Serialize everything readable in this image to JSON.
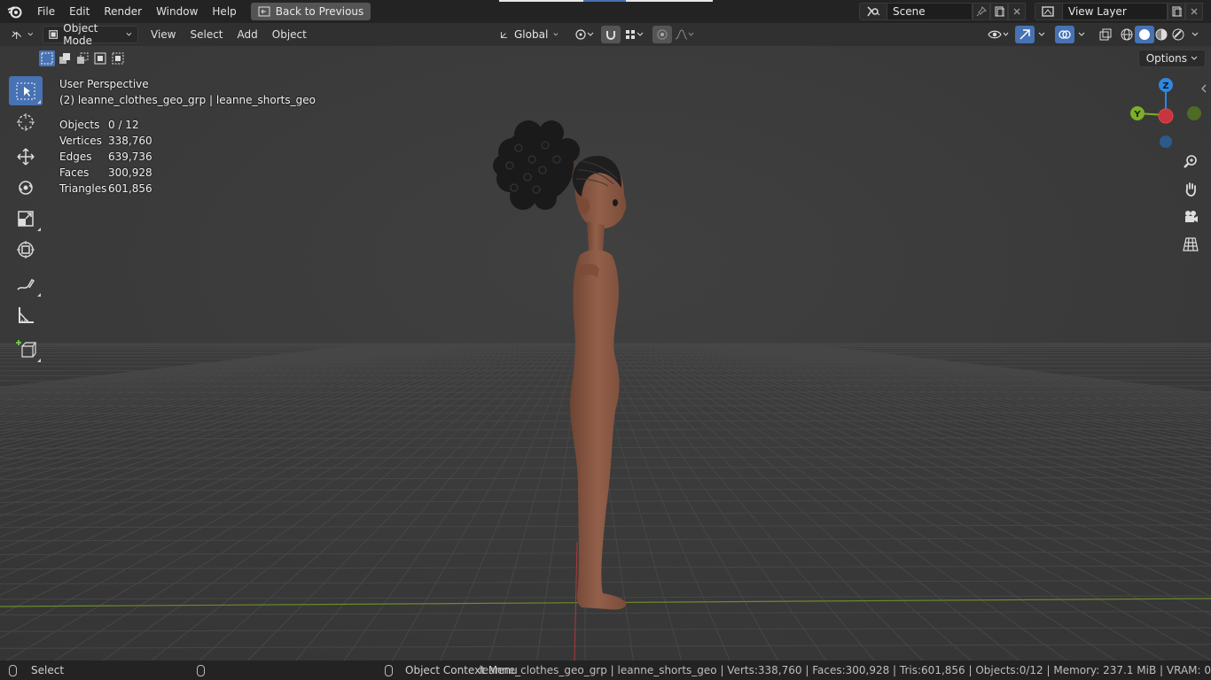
{
  "menu": {
    "items": [
      "File",
      "Edit",
      "Render",
      "Window",
      "Help"
    ],
    "back_button": "Back to Previous"
  },
  "scene": {
    "name": "Scene",
    "view_layer": "View Layer"
  },
  "header": {
    "mode": "Object Mode",
    "menus": [
      "View",
      "Select",
      "Add",
      "Object"
    ],
    "transform_orientation": "Global",
    "options_label": "Options"
  },
  "viewport": {
    "perspective": "User Perspective",
    "active_object": "(2) leanne_clothes_geo_grp | leanne_shorts_geo",
    "stats": [
      {
        "label": "Objects",
        "value": "0 / 12"
      },
      {
        "label": "Vertices",
        "value": "338,760"
      },
      {
        "label": "Edges",
        "value": "639,736"
      },
      {
        "label": "Faces",
        "value": "300,928"
      },
      {
        "label": "Triangles",
        "value": "601,856"
      }
    ],
    "gizmo": {
      "z": "Z",
      "y": "Y"
    }
  },
  "statusbar": {
    "select": "Select",
    "context_menu": "Object Context Menu",
    "info": "leanne_clothes_geo_grp | leanne_shorts_geo | Verts:338,760 | Faces:300,928 | Tris:601,856 | Objects:0/12 | Memory: 237.1 MiB | VRAM: 0"
  },
  "colors": {
    "accent": "#4772b3",
    "axis_x": "#e2464f",
    "axis_y": "#7fae2a",
    "axis_z": "#2e88e0",
    "skin": "#8a5a44",
    "hair": "#1b1b1b"
  }
}
